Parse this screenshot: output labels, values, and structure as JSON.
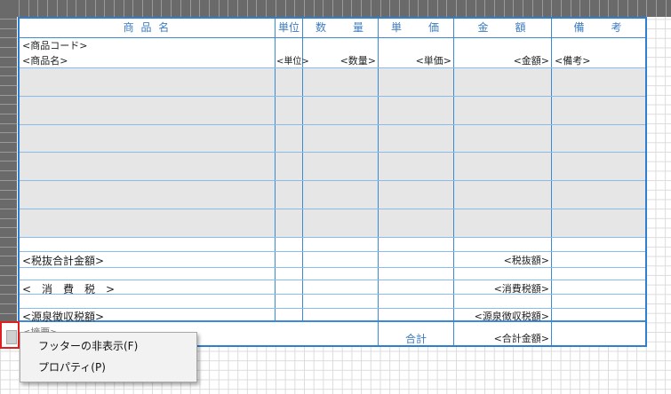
{
  "header": {
    "product_name": "商 品 名",
    "unit": "単位",
    "quantity": "数　　量",
    "unit_price": "単　　価",
    "amount": "金　　額",
    "remarks": "備　　考"
  },
  "detail": {
    "product_code": "<商品コード>",
    "product_name": "<商品名>",
    "unit": "<単位>",
    "quantity": "<数量>",
    "unit_price": "<単価>",
    "amount": "<金額>",
    "remarks": "<備考>"
  },
  "summary": {
    "subtotal_label": "<税抜合計金額>",
    "subtotal_value": "<税抜額>",
    "tax_label": "<　消　費　税　>",
    "tax_value": "<消費税額>",
    "withholding_label": "<源泉徴収税額>",
    "withholding_value": "<源泉徴収税額>"
  },
  "footer": {
    "memo_label": "<摘要>",
    "total_label": "合計",
    "total_value": "<合計金額>"
  },
  "context_menu": {
    "items": [
      {
        "label": "フッターの非表示(F)"
      },
      {
        "label": "プロパティ(P)"
      }
    ]
  },
  "colors": {
    "frame": "#2f7fd0",
    "header_text": "#3d7cc2",
    "selector_border": "#e02020",
    "ruler": "#6a6a6a"
  }
}
